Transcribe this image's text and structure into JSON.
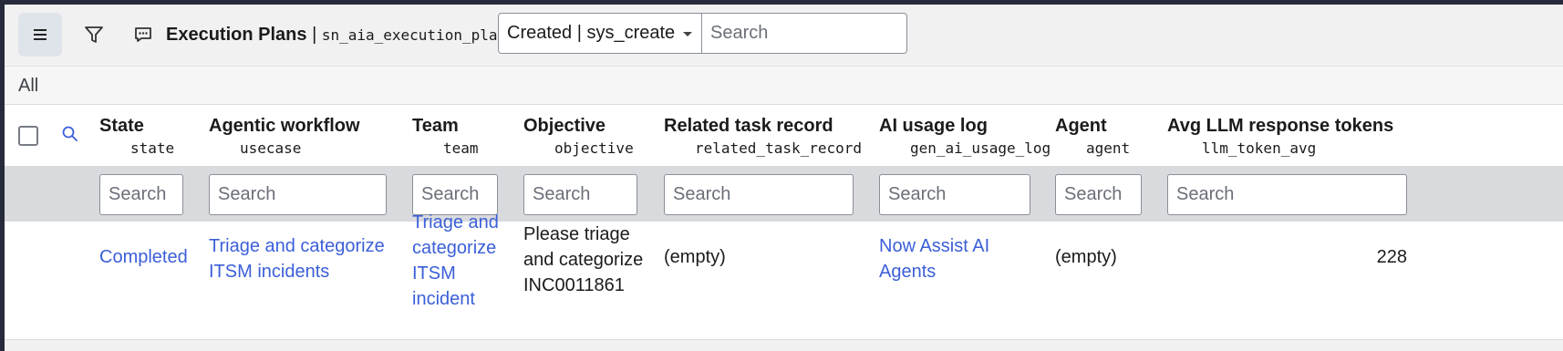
{
  "header": {
    "menu_icon": "hamburger-menu-icon",
    "filter_icon": "filter-funnel-icon",
    "chat_icon": "comment-icon",
    "title": "Execution Plans",
    "separator": "|",
    "table_name": "sn_aia_execution_plan",
    "field_select": "Created | sys_create",
    "search_placeholder": "Search"
  },
  "breadcrumb": {
    "label": "All"
  },
  "columns": [
    {
      "label": "State",
      "field": "state"
    },
    {
      "label": "Agentic workflow",
      "field": "usecase"
    },
    {
      "label": "Team",
      "field": "team"
    },
    {
      "label": "Objective",
      "field": "objective"
    },
    {
      "label": "Related task record",
      "field": "related_task_record"
    },
    {
      "label": "AI usage log",
      "field": "gen_ai_usage_log"
    },
    {
      "label": "Agent",
      "field": "agent"
    },
    {
      "label": "Avg LLM response tokens",
      "field": "llm_token_avg"
    }
  ],
  "column_search_placeholder": "Search",
  "rows": [
    {
      "state": "Completed",
      "usecase": "Triage and categorize ITSM incidents",
      "team": "Triage and categorize ITSM incident",
      "objective": "Please triage and categorize INC0011861",
      "related_task_record": "(empty)",
      "gen_ai_usage_log": "Now Assist AI Agents",
      "agent": "(empty)",
      "llm_token_avg": "228"
    }
  ],
  "colors": {
    "accent_link": "#3b5fd8",
    "header_bg": "#f1f1f2",
    "search_row_bg": "#d9dadd",
    "frame": "#272a3a"
  }
}
